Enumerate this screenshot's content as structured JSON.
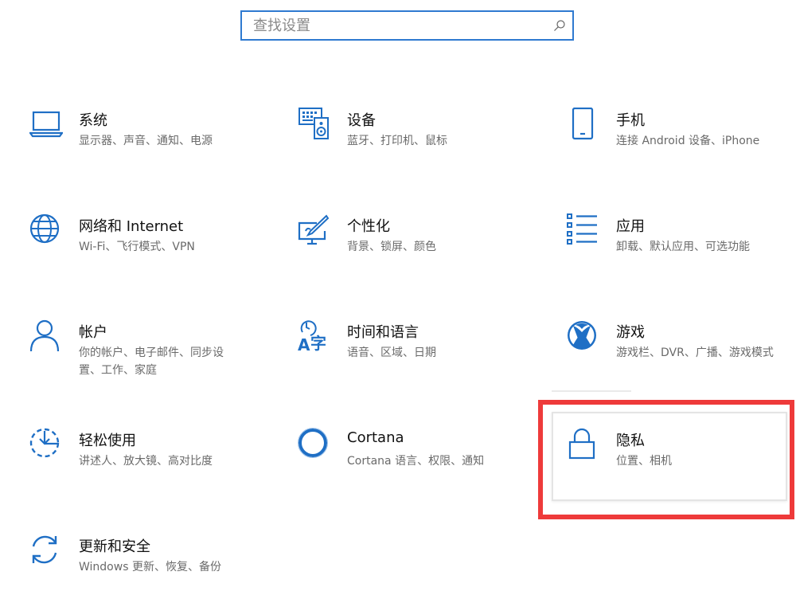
{
  "search": {
    "placeholder": "查找设置"
  },
  "tiles": [
    {
      "title": "系统",
      "desc": "显示器、声音、通知、电源"
    },
    {
      "title": "设备",
      "desc": "蓝牙、打印机、鼠标"
    },
    {
      "title": "手机",
      "desc": "连接 Android 设备、iPhone"
    },
    {
      "title": "网络和 Internet",
      "desc": "Wi-Fi、飞行模式、VPN"
    },
    {
      "title": "个性化",
      "desc": "背景、锁屏、颜色"
    },
    {
      "title": "应用",
      "desc": "卸载、默认应用、可选功能"
    },
    {
      "title": "帐户",
      "desc": "你的帐户、电子邮件、同步设置、工作、家庭"
    },
    {
      "title": "时间和语言",
      "desc": "语音、区域、日期"
    },
    {
      "title": "游戏",
      "desc": "游戏栏、DVR、广播、游戏模式"
    },
    {
      "title": "轻松使用",
      "desc": "讲述人、放大镜、高对比度"
    },
    {
      "title": "Cortana",
      "desc": "Cortana 语言、权限、通知"
    },
    {
      "title": "隐私",
      "desc": "位置、相机"
    },
    {
      "title": "更新和安全",
      "desc": "Windows 更新、恢复、备份"
    }
  ],
  "colors": {
    "accent": "#2f7ad0",
    "icon_blue": "#1f6fc5",
    "highlight_red": "#ee3a3a"
  },
  "icons": [
    "laptop-icon",
    "devices-icon",
    "phone-icon",
    "globe-icon",
    "personalization-icon",
    "apps-icon",
    "person-icon",
    "time-language-icon",
    "xbox-icon",
    "ease-of-access-icon",
    "cortana-icon",
    "lock-icon",
    "update-icon"
  ]
}
